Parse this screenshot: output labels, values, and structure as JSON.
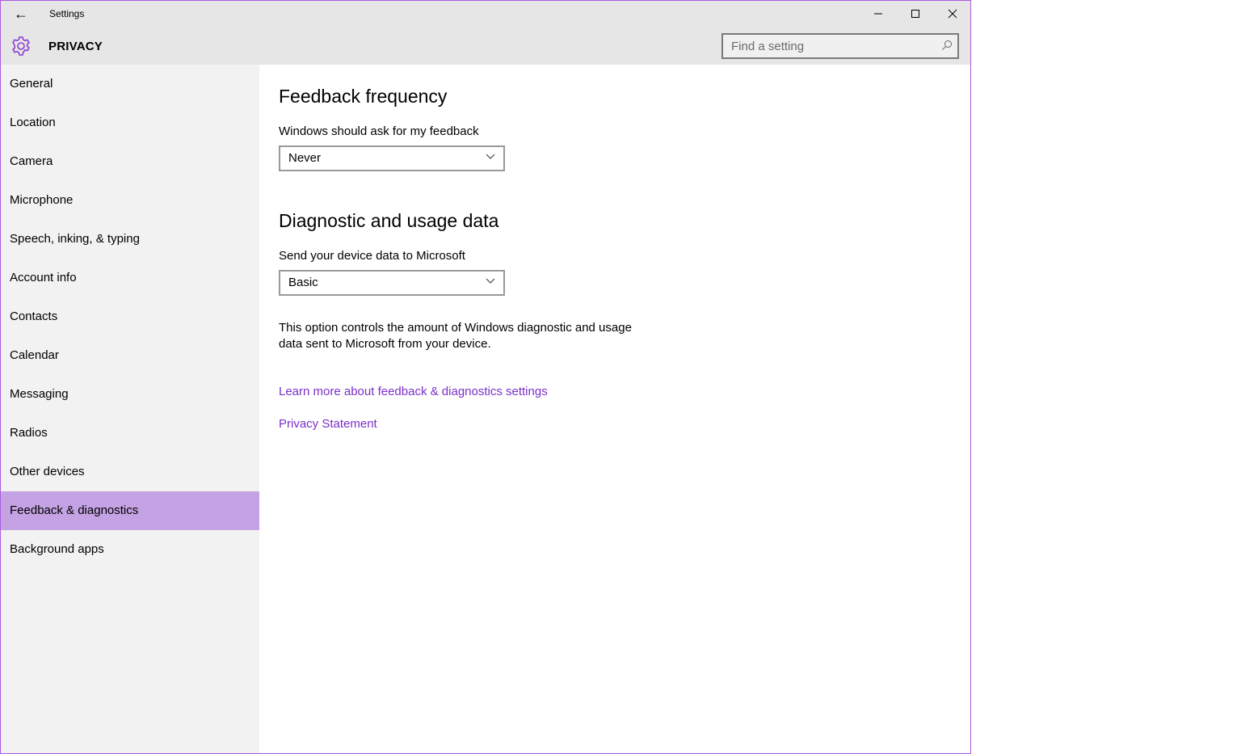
{
  "window": {
    "title": "Settings",
    "border_color": "#a95de0"
  },
  "header": {
    "title": "PRIVACY",
    "icon": "gear-icon",
    "accent": "#8a3fd1"
  },
  "search": {
    "placeholder": "Find a setting"
  },
  "sidebar": {
    "selected_color": "#c4a2e4",
    "items": [
      {
        "label": "General"
      },
      {
        "label": "Location"
      },
      {
        "label": "Camera"
      },
      {
        "label": "Microphone"
      },
      {
        "label": "Speech, inking, & typing"
      },
      {
        "label": "Account info"
      },
      {
        "label": "Contacts"
      },
      {
        "label": "Calendar"
      },
      {
        "label": "Messaging"
      },
      {
        "label": "Radios"
      },
      {
        "label": "Other devices"
      },
      {
        "label": "Feedback & diagnostics",
        "selected": true
      },
      {
        "label": "Background apps"
      }
    ]
  },
  "main": {
    "feedback": {
      "heading": "Feedback frequency",
      "label": "Windows should ask for my feedback",
      "value": "Never"
    },
    "diagnostic": {
      "heading": "Diagnostic and usage data",
      "label": "Send your device data to Microsoft",
      "value": "Basic",
      "description": "This option controls the amount of Windows diagnostic and usage data sent to Microsoft from your device."
    },
    "links": [
      "Learn more about feedback & diagnostics settings",
      "Privacy Statement"
    ],
    "link_color": "#7b2fc9"
  }
}
